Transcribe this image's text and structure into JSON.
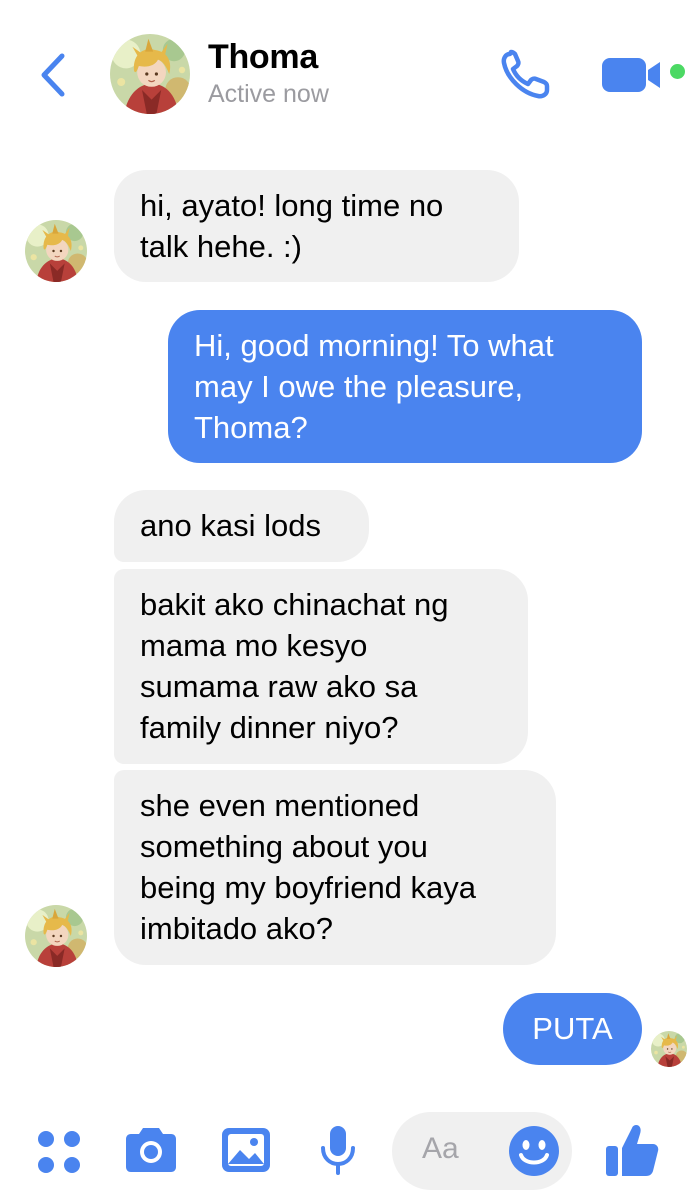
{
  "colors": {
    "accent": "#4a84ef",
    "incoming_bubble": "#f0f0f0",
    "status_text": "#9b9ba0",
    "active_dot": "#4cd964"
  },
  "header": {
    "contact_name": "Thoma",
    "status": "Active now",
    "icons": [
      "chevron-left-icon",
      "phone-icon",
      "video-camera-icon"
    ]
  },
  "messages": [
    {
      "sender": "contact",
      "text": "hi, ayato! long time no\ntalk hehe. :)"
    },
    {
      "sender": "me",
      "text": "Hi, good morning! To what\nmay I owe the pleasure,\nThoma?"
    },
    {
      "sender": "contact",
      "text": "ano kasi lods"
    },
    {
      "sender": "contact",
      "text": "bakit ako chinachat ng\nmama mo kesyo\nsumama raw ako sa\nfamily dinner niyo?"
    },
    {
      "sender": "contact",
      "text": "she even mentioned\nsomething about you\nbeing my boyfriend kaya\nimbitado ako?"
    },
    {
      "sender": "me",
      "text": "PUTA"
    }
  ],
  "composer": {
    "placeholder": "Aa",
    "icons": [
      "apps-grid-icon",
      "camera-icon",
      "photo-gallery-icon",
      "microphone-icon",
      "emoji-icon",
      "thumbs-up-icon"
    ]
  }
}
